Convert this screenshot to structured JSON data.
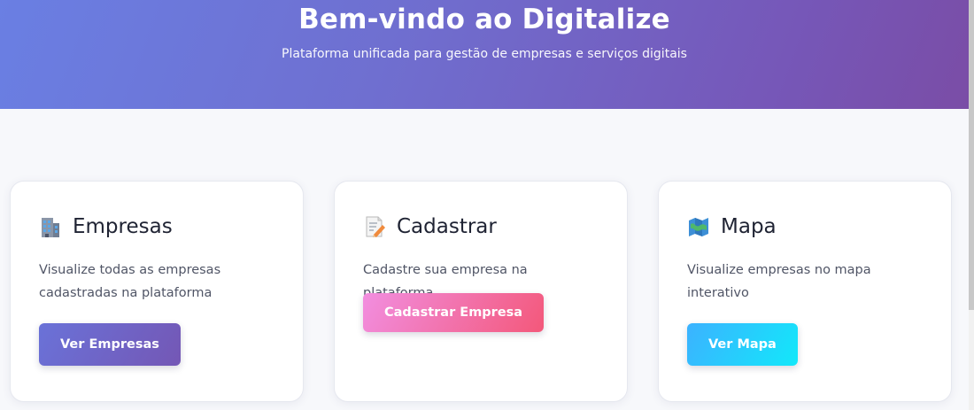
{
  "hero": {
    "title": "Bem-vindo ao Digitalize",
    "subtitle": "Plataforma unificada para gestão de empresas e serviços digitais"
  },
  "cards": [
    {
      "title": "Empresas",
      "icon": "building-icon",
      "description": "Visualize todas as empresas cadastradas na plataforma",
      "button_label": "Ver Empresas"
    },
    {
      "title": "Cadastrar",
      "icon": "memo-icon",
      "description": "Cadastre sua empresa na plataforma",
      "button_label": "Cadastrar Empresa"
    },
    {
      "title": "Mapa",
      "icon": "map-icon",
      "description": "Visualize empresas no mapa interativo",
      "button_label": "Ver Mapa"
    }
  ],
  "colors": {
    "hero_gradient_start": "#6a7fe3",
    "hero_gradient_end": "#7a4da6",
    "empresas_button": "#6a72d8",
    "cadastrar_button": "#f3587a",
    "mapa_button": "#12e8fa"
  }
}
